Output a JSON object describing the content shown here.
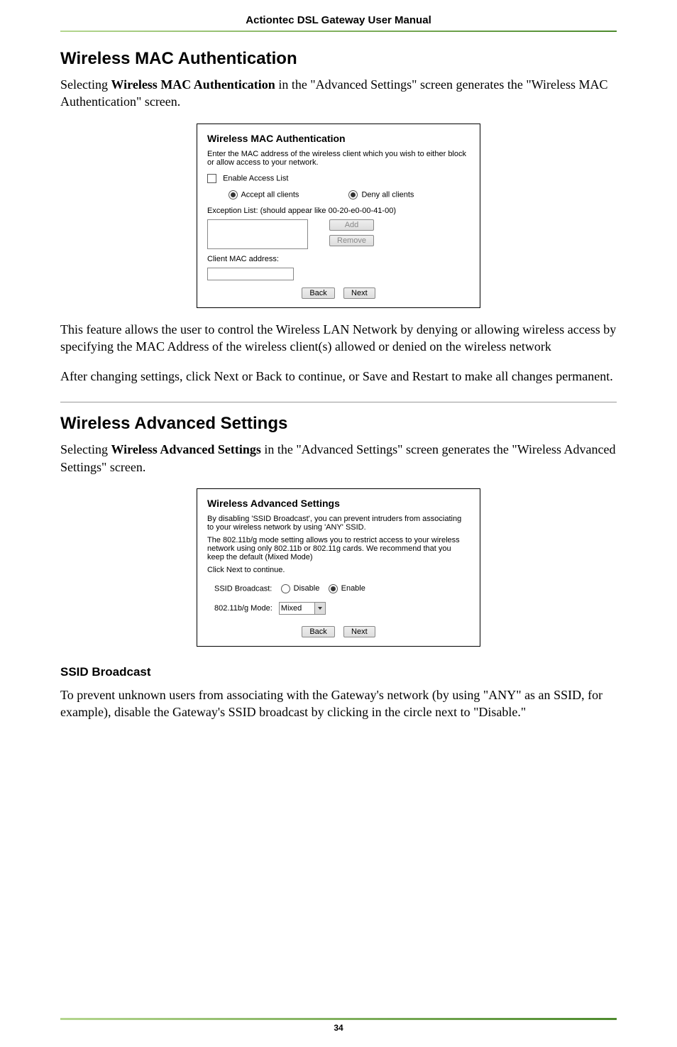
{
  "runner": "Actiontec DSL Gateway User Manual",
  "section1": {
    "title": "Wireless MAC Authentication",
    "p1_a": "Selecting ",
    "p1_b": "Wireless MAC Authentication",
    "p1_c": " in the \"Advanced Settings\" screen generates the \"Wireless ",
    "p1_smallcaps": "MAC",
    "p1_d": " Authentication\" screen.",
    "fig": {
      "title": "Wireless MAC Authentication",
      "intro": "Enter the MAC address of the wireless client which you wish to either block or allow access to your network.",
      "enable": "Enable Access List",
      "accept": "Accept all clients",
      "deny": "Deny all clients",
      "exception": "Exception List: (should appear like 00-20-e0-00-41-00)",
      "add": "Add",
      "remove": "Remove",
      "client_mac": "Client MAC address:",
      "back": "Back",
      "next": "Next"
    },
    "p2_a": "This feature allows the user to control the Wireless ",
    "p2_sc1": "LAN",
    "p2_b": " Network by denying or allowing wireless access by specifying the ",
    "p2_sc2": "MAC",
    "p2_c": " Address of the wireless client(s) allowed or denied on the wireless network",
    "p3": "After changing settings, click Next or Back to continue, or Save and Restart to make all changes permanent."
  },
  "section2": {
    "title": "Wireless Advanced Settings",
    "p1_a": "Selecting ",
    "p1_b": "Wireless Advanced Settings",
    "p1_c": " in the \"Advanced Settings\" screen generates the \"Wireless Advanced Settings\" screen.",
    "fig": {
      "title": "Wireless Advanced Settings",
      "intro1": "By disabling 'SSID Broadcast', you can prevent intruders from associating to your wireless network by using 'ANY' SSID.",
      "intro2": "The 802.11b/g mode setting allows you to restrict access to your wireless network using only 802.11b or 802.11g cards. We recommend that you keep the default (Mixed Mode)",
      "click_next": "Click Next to continue.",
      "ssid_label": "SSID Broadcast:",
      "disable": "Disable",
      "enable": "Enable",
      "mode_label": "802.11b/g Mode:",
      "mode_value": "Mixed",
      "back": "Back",
      "next": "Next"
    }
  },
  "section3": {
    "title": "SSID Broadcast",
    "p1_a": "To prevent unknown users from associating with the Gateway's network (by using \"",
    "p1_sc1": "ANY",
    "p1_b": "\" as an ",
    "p1_sc2": "SSID",
    "p1_c": ", for example), disable the Gateway's ",
    "p1_sc3": "SSID",
    "p1_d": " broadcast by clicking in the circle next to \"Disable.\""
  },
  "page_number": "34"
}
